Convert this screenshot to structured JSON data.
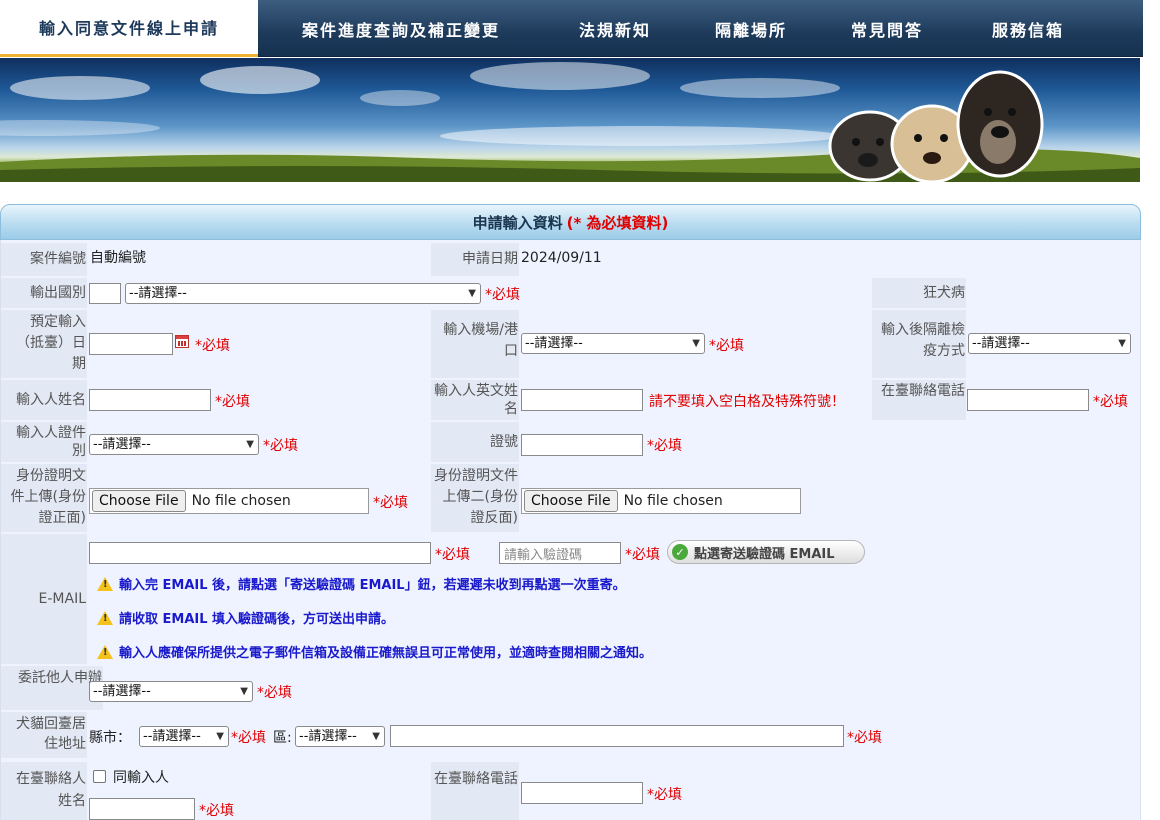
{
  "nav": {
    "tabs": [
      {
        "label": "輸入同意文件線上申請",
        "active": true
      },
      {
        "label": "案件進度查詢及補正變更",
        "active": false
      },
      {
        "label": "法規新知",
        "active": false
      },
      {
        "label": "隔離場所",
        "active": false
      },
      {
        "label": "常見問答",
        "active": false
      },
      {
        "label": "服務信箱",
        "active": false
      }
    ]
  },
  "panel": {
    "title": "申請輸入資料",
    "required_note": "(* 為必填資料)"
  },
  "required_label": "*必填",
  "form": {
    "case_no": {
      "label": "案件編號",
      "value": "自動編號"
    },
    "apply_date": {
      "label": "申請日期",
      "value": "2024/09/11"
    },
    "export_country": {
      "label": "輸出國別",
      "code": "",
      "select": "--請選擇--"
    },
    "rabies": {
      "label": "狂犬病"
    },
    "import_date": {
      "label": "預定輸入（抵臺）日期",
      "value": ""
    },
    "import_port": {
      "label": "輸入機場/港口",
      "select": "--請選擇--"
    },
    "quarantine": {
      "label": "輸入後隔離檢疫方式",
      "select": "--請選擇--"
    },
    "importer_name": {
      "label": "輸入人姓名",
      "value": ""
    },
    "importer_en_name": {
      "label": "輸入人英文姓名",
      "value": "",
      "hint": "請不要填入空白格及特殊符號！"
    },
    "tw_phone": {
      "label": "在臺聯絡電話",
      "value": ""
    },
    "id_type": {
      "label": "輸入人證件別",
      "select": "--請選擇--"
    },
    "id_no": {
      "label": "證號",
      "value": ""
    },
    "id_front": {
      "label": "身份證明文件上傳(身份證正面)",
      "button": "Choose File",
      "file": "No file chosen"
    },
    "id_back": {
      "label": "身份證明文件上傳二(身份證反面)",
      "button": "Choose File",
      "file": "No file chosen"
    },
    "email": {
      "label": "E-MAIL",
      "value": "",
      "code_placeholder": "請輸入驗證碼",
      "send_button": "點選寄送驗證碼 EMAIL",
      "notices": [
        "輸入完 EMAIL 後，請點選「寄送驗證碼 EMAIL」鈕，若遲遲未收到再點選一次重寄。",
        "請收取 EMAIL 填入驗證碼後，方可送出申請。",
        "輸入人應確保所提供之電子郵件信箱及設備正確無誤且可正常使用，並適時查閱相關之通知。"
      ]
    },
    "delegate": {
      "label": "委託他人申辦",
      "select": "--請選擇--"
    },
    "address": {
      "label": "犬貓回臺居住地址",
      "city_label": "縣市：",
      "city_select": "--請選擇--",
      "district_label": "區:",
      "district_select": "--請選擇--",
      "detail": ""
    },
    "contact_name": {
      "label": "在臺聯絡人姓名",
      "same_as": "同輸入人",
      "value": ""
    },
    "contact_phone": {
      "label": "在臺聯絡電話",
      "value": ""
    }
  }
}
